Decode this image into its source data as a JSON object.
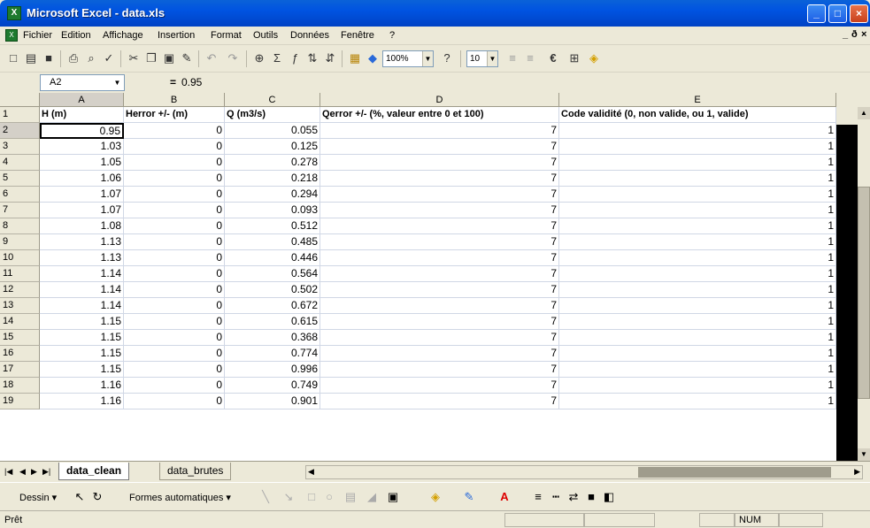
{
  "window": {
    "title": "Microsoft Excel - data.xls",
    "icon": "excel-icon"
  },
  "menu": [
    "Fichier",
    "Edition",
    "Affichage",
    "Insertion",
    "Format",
    "Outils",
    "Données",
    "Fenêtre",
    "?"
  ],
  "toolbar": {
    "zoom": "100%",
    "font_size": "10"
  },
  "formula_bar": {
    "name_box": "A2",
    "equals": "=",
    "value": "0.95"
  },
  "columns": [
    "A",
    "B",
    "C",
    "D",
    "E"
  ],
  "headers": {
    "A": "H (m)",
    "B": "Herror +/- (m)",
    "C": "Q (m3/s)",
    "D": "Qerror +/- (%, valeur entre 0 et 100)",
    "E": "Code validité (0, non valide, ou 1, valide)"
  },
  "rows": [
    {
      "n": "1"
    },
    {
      "n": "2",
      "a": "0.95",
      "b": "0",
      "c": "0.055",
      "d": "7",
      "e": "1"
    },
    {
      "n": "3",
      "a": "1.03",
      "b": "0",
      "c": "0.125",
      "d": "7",
      "e": "1"
    },
    {
      "n": "4",
      "a": "1.05",
      "b": "0",
      "c": "0.278",
      "d": "7",
      "e": "1"
    },
    {
      "n": "5",
      "a": "1.06",
      "b": "0",
      "c": "0.218",
      "d": "7",
      "e": "1"
    },
    {
      "n": "6",
      "a": "1.07",
      "b": "0",
      "c": "0.294",
      "d": "7",
      "e": "1"
    },
    {
      "n": "7",
      "a": "1.07",
      "b": "0",
      "c": "0.093",
      "d": "7",
      "e": "1"
    },
    {
      "n": "8",
      "a": "1.08",
      "b": "0",
      "c": "0.512",
      "d": "7",
      "e": "1"
    },
    {
      "n": "9",
      "a": "1.13",
      "b": "0",
      "c": "0.485",
      "d": "7",
      "e": "1"
    },
    {
      "n": "10",
      "a": "1.13",
      "b": "0",
      "c": "0.446",
      "d": "7",
      "e": "1"
    },
    {
      "n": "11",
      "a": "1.14",
      "b": "0",
      "c": "0.564",
      "d": "7",
      "e": "1"
    },
    {
      "n": "12",
      "a": "1.14",
      "b": "0",
      "c": "0.502",
      "d": "7",
      "e": "1"
    },
    {
      "n": "13",
      "a": "1.14",
      "b": "0",
      "c": "0.672",
      "d": "7",
      "e": "1"
    },
    {
      "n": "14",
      "a": "1.15",
      "b": "0",
      "c": "0.615",
      "d": "7",
      "e": "1"
    },
    {
      "n": "15",
      "a": "1.15",
      "b": "0",
      "c": "0.368",
      "d": "7",
      "e": "1"
    },
    {
      "n": "16",
      "a": "1.15",
      "b": "0",
      "c": "0.774",
      "d": "7",
      "e": "1"
    },
    {
      "n": "17",
      "a": "1.15",
      "b": "0",
      "c": "0.996",
      "d": "7",
      "e": "1"
    },
    {
      "n": "18",
      "a": "1.16",
      "b": "0",
      "c": "0.749",
      "d": "7",
      "e": "1"
    },
    {
      "n": "19",
      "a": "1.16",
      "b": "0",
      "c": "0.901",
      "d": "7",
      "e": "1"
    }
  ],
  "sheets": [
    "data_clean",
    "data_brutes"
  ],
  "draw_toolbar": {
    "dessin": "Dessin ▾",
    "formes": "Formes automatiques ▾"
  },
  "status": {
    "text": "Prêt",
    "num": "NUM"
  }
}
